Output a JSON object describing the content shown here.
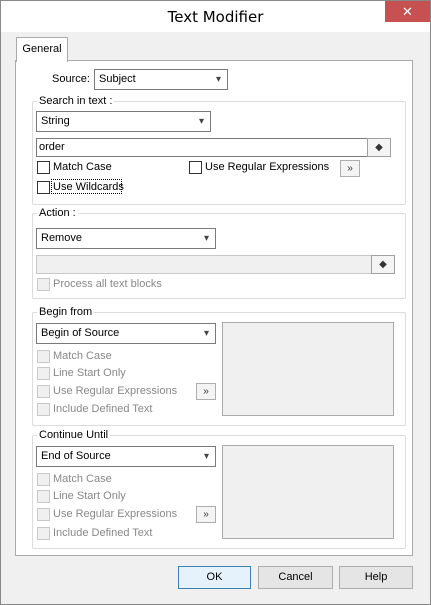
{
  "window": {
    "title": "Text Modifier",
    "close_glyph": "✕"
  },
  "tab": {
    "label": "General"
  },
  "source": {
    "label": "Source:",
    "value": "Subject"
  },
  "search": {
    "group_title": "Search in text :",
    "type_value": "String",
    "text_value": "order",
    "match_case": "Match Case",
    "use_regex": "Use Regular Expressions",
    "use_wildcards": "Use Wildcards"
  },
  "action": {
    "group_title": "Action :",
    "value": "Remove",
    "text_value": "",
    "process_all": "Process all text blocks"
  },
  "begin": {
    "group_title": "Begin from",
    "value": "Begin of Source",
    "match_case": "Match Case",
    "line_start": "Line Start Only",
    "use_regex": "Use Regular Expressions",
    "include_defined": "Include Defined Text"
  },
  "continue": {
    "group_title": "Continue Until",
    "value": "End of Source",
    "match_case": "Match Case",
    "line_start": "Line Start Only",
    "use_regex": "Use Regular Expressions",
    "include_defined": "Include Defined Text"
  },
  "buttons": {
    "ok": "OK",
    "cancel": "Cancel",
    "help": "Help"
  },
  "icons": {
    "dropdown": "▾",
    "more": "»",
    "picker": "◆"
  }
}
